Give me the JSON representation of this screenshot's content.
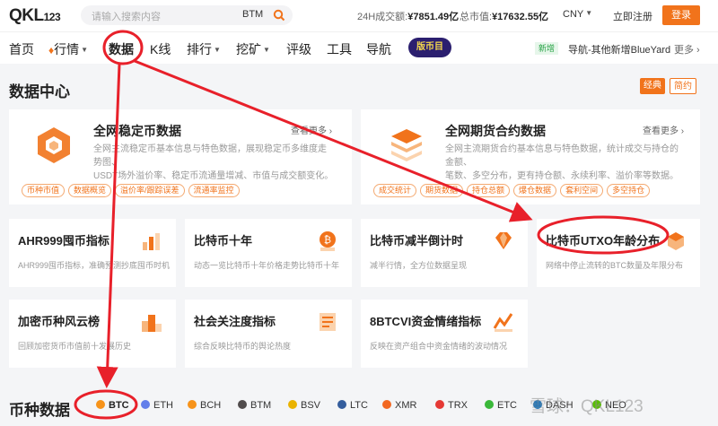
{
  "header": {
    "logo_main": "QKL",
    "logo_small": "123",
    "search_placeholder": "请输入搜索内容",
    "search_value": "BTM",
    "volume_label": "24H成交额:",
    "volume_value": "¥7851.49亿",
    "mcap_label": "总市值:",
    "mcap_value": "¥17632.55亿",
    "currency": "CNY",
    "register": "立即注册",
    "login": "登录"
  },
  "nav": {
    "items": [
      "首页",
      "行情",
      "数据",
      "K线",
      "排行",
      "挖矿",
      "评级",
      "工具",
      "导航"
    ],
    "promo": "版币目",
    "new_badge": "新增",
    "new_text": "导航-其他新增BlueYard",
    "more": "更多"
  },
  "datacenter": {
    "title": "数据中心",
    "toggle_on": "经典",
    "toggle_off": "简约",
    "cards": [
      {
        "title": "全网稳定币数据",
        "see_more": "查看更多",
        "desc1": "全网主流稳定币基本信息与特色数据，展现稳定币多维度走势图、",
        "desc2": "USDT场外溢价率、稳定币流通量增减、市值与成交额变化。",
        "tags": [
          "币种市值",
          "数据概览",
          "溢价率/跟踪误差",
          "流通率监控"
        ]
      },
      {
        "title": "全网期货合约数据",
        "see_more": "查看更多",
        "desc1": "全网主流期货合约基本信息与特色数据，统计成交与持仓的金额、",
        "desc2": "笔数、多空分布，更有持仓额、永续利率、溢价率等数据。",
        "tags": [
          "成交统计",
          "期货数据",
          "持仓总额",
          "爆仓数据",
          "套利空间",
          "多空持仓"
        ]
      }
    ],
    "small_cards": [
      {
        "title": "AHR999囤币指标",
        "desc": "AHR999囤币指标，准确预测抄底囤币时机"
      },
      {
        "title": "比特币十年",
        "desc": "动态一览比特币十年价格走势比特币十年"
      },
      {
        "title": "比特币减半倒计时",
        "desc": "减半行情，全方位数据呈现"
      },
      {
        "title": "比特币UTXO年龄分布",
        "desc": "网络中停止流转的BTC数量及年限分布"
      },
      {
        "title": "加密币种风云榜",
        "desc": "回顾加密货币市值前十发展历史"
      },
      {
        "title": "社会关注度指标",
        "desc": "综合反映比特币的舆论热度"
      },
      {
        "title": "8BTCVI资金情绪指标",
        "desc": "反映在资产组合中资金情绪的波动情况"
      }
    ]
  },
  "coins": {
    "title": "币种数据",
    "tabs": [
      "BTC",
      "ETH",
      "BCH",
      "BTM",
      "BSV",
      "LTC",
      "XMR",
      "TRX",
      "ETC",
      "DASH",
      "NEO"
    ],
    "colors": [
      "#f7931a",
      "#627eea",
      "#f7931a",
      "#504c4c",
      "#eab300",
      "#345d9d",
      "#f26822",
      "#e53935",
      "#3ab83a",
      "#1c75bc",
      "#58bf00"
    ]
  },
  "watermark": "雪球：QKL123",
  "colors": {
    "accent": "#f1731b",
    "annotation": "#e8202a"
  }
}
